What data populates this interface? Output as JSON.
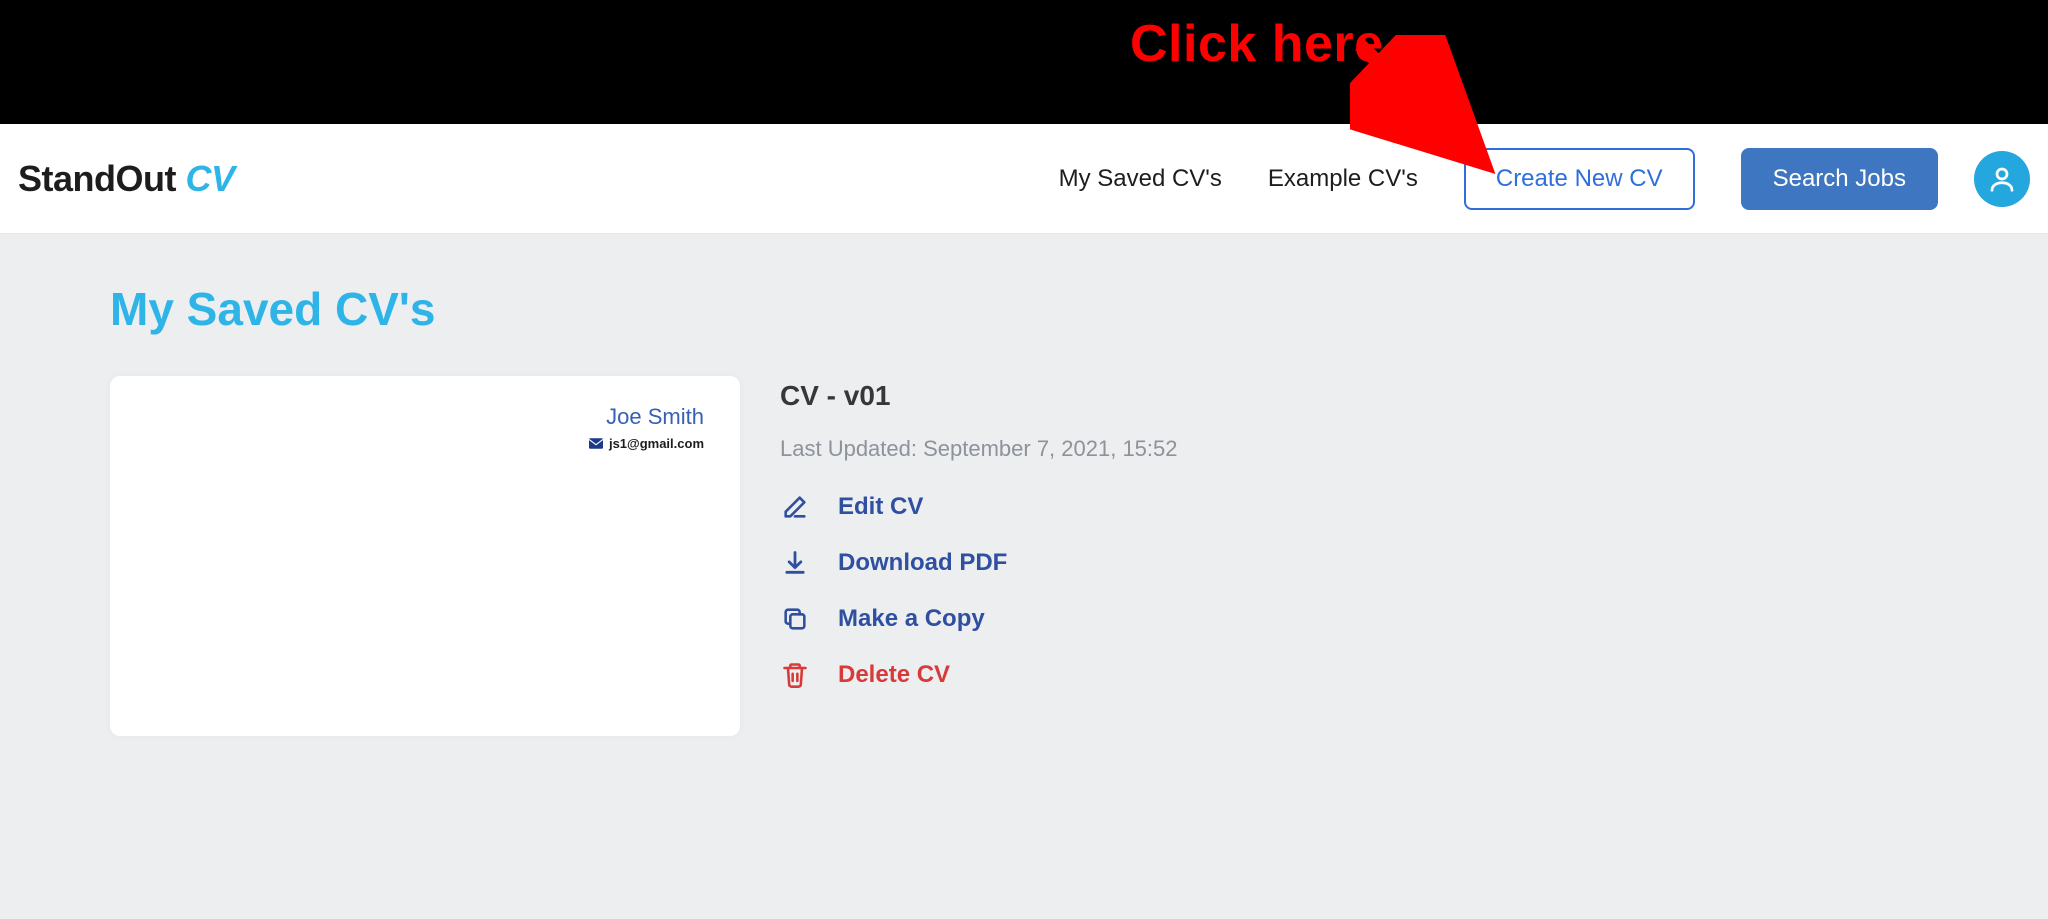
{
  "annotation": {
    "label": "Click here"
  },
  "header": {
    "logo_part1": "StandOut ",
    "logo_part2": "CV",
    "nav": {
      "my_saved": "My Saved CV's",
      "example": "Example CV's",
      "create": "Create New CV",
      "search": "Search Jobs"
    }
  },
  "page": {
    "title": "My Saved CV's"
  },
  "cv_preview": {
    "name": "Joe Smith",
    "email": "js1@gmail.com"
  },
  "cv_meta": {
    "title": "CV - v01",
    "last_updated": "Last Updated: September 7, 2021, 15:52",
    "actions": {
      "edit": "Edit CV",
      "download": "Download PDF",
      "copy": "Make a Copy",
      "delete": "Delete CV"
    }
  }
}
